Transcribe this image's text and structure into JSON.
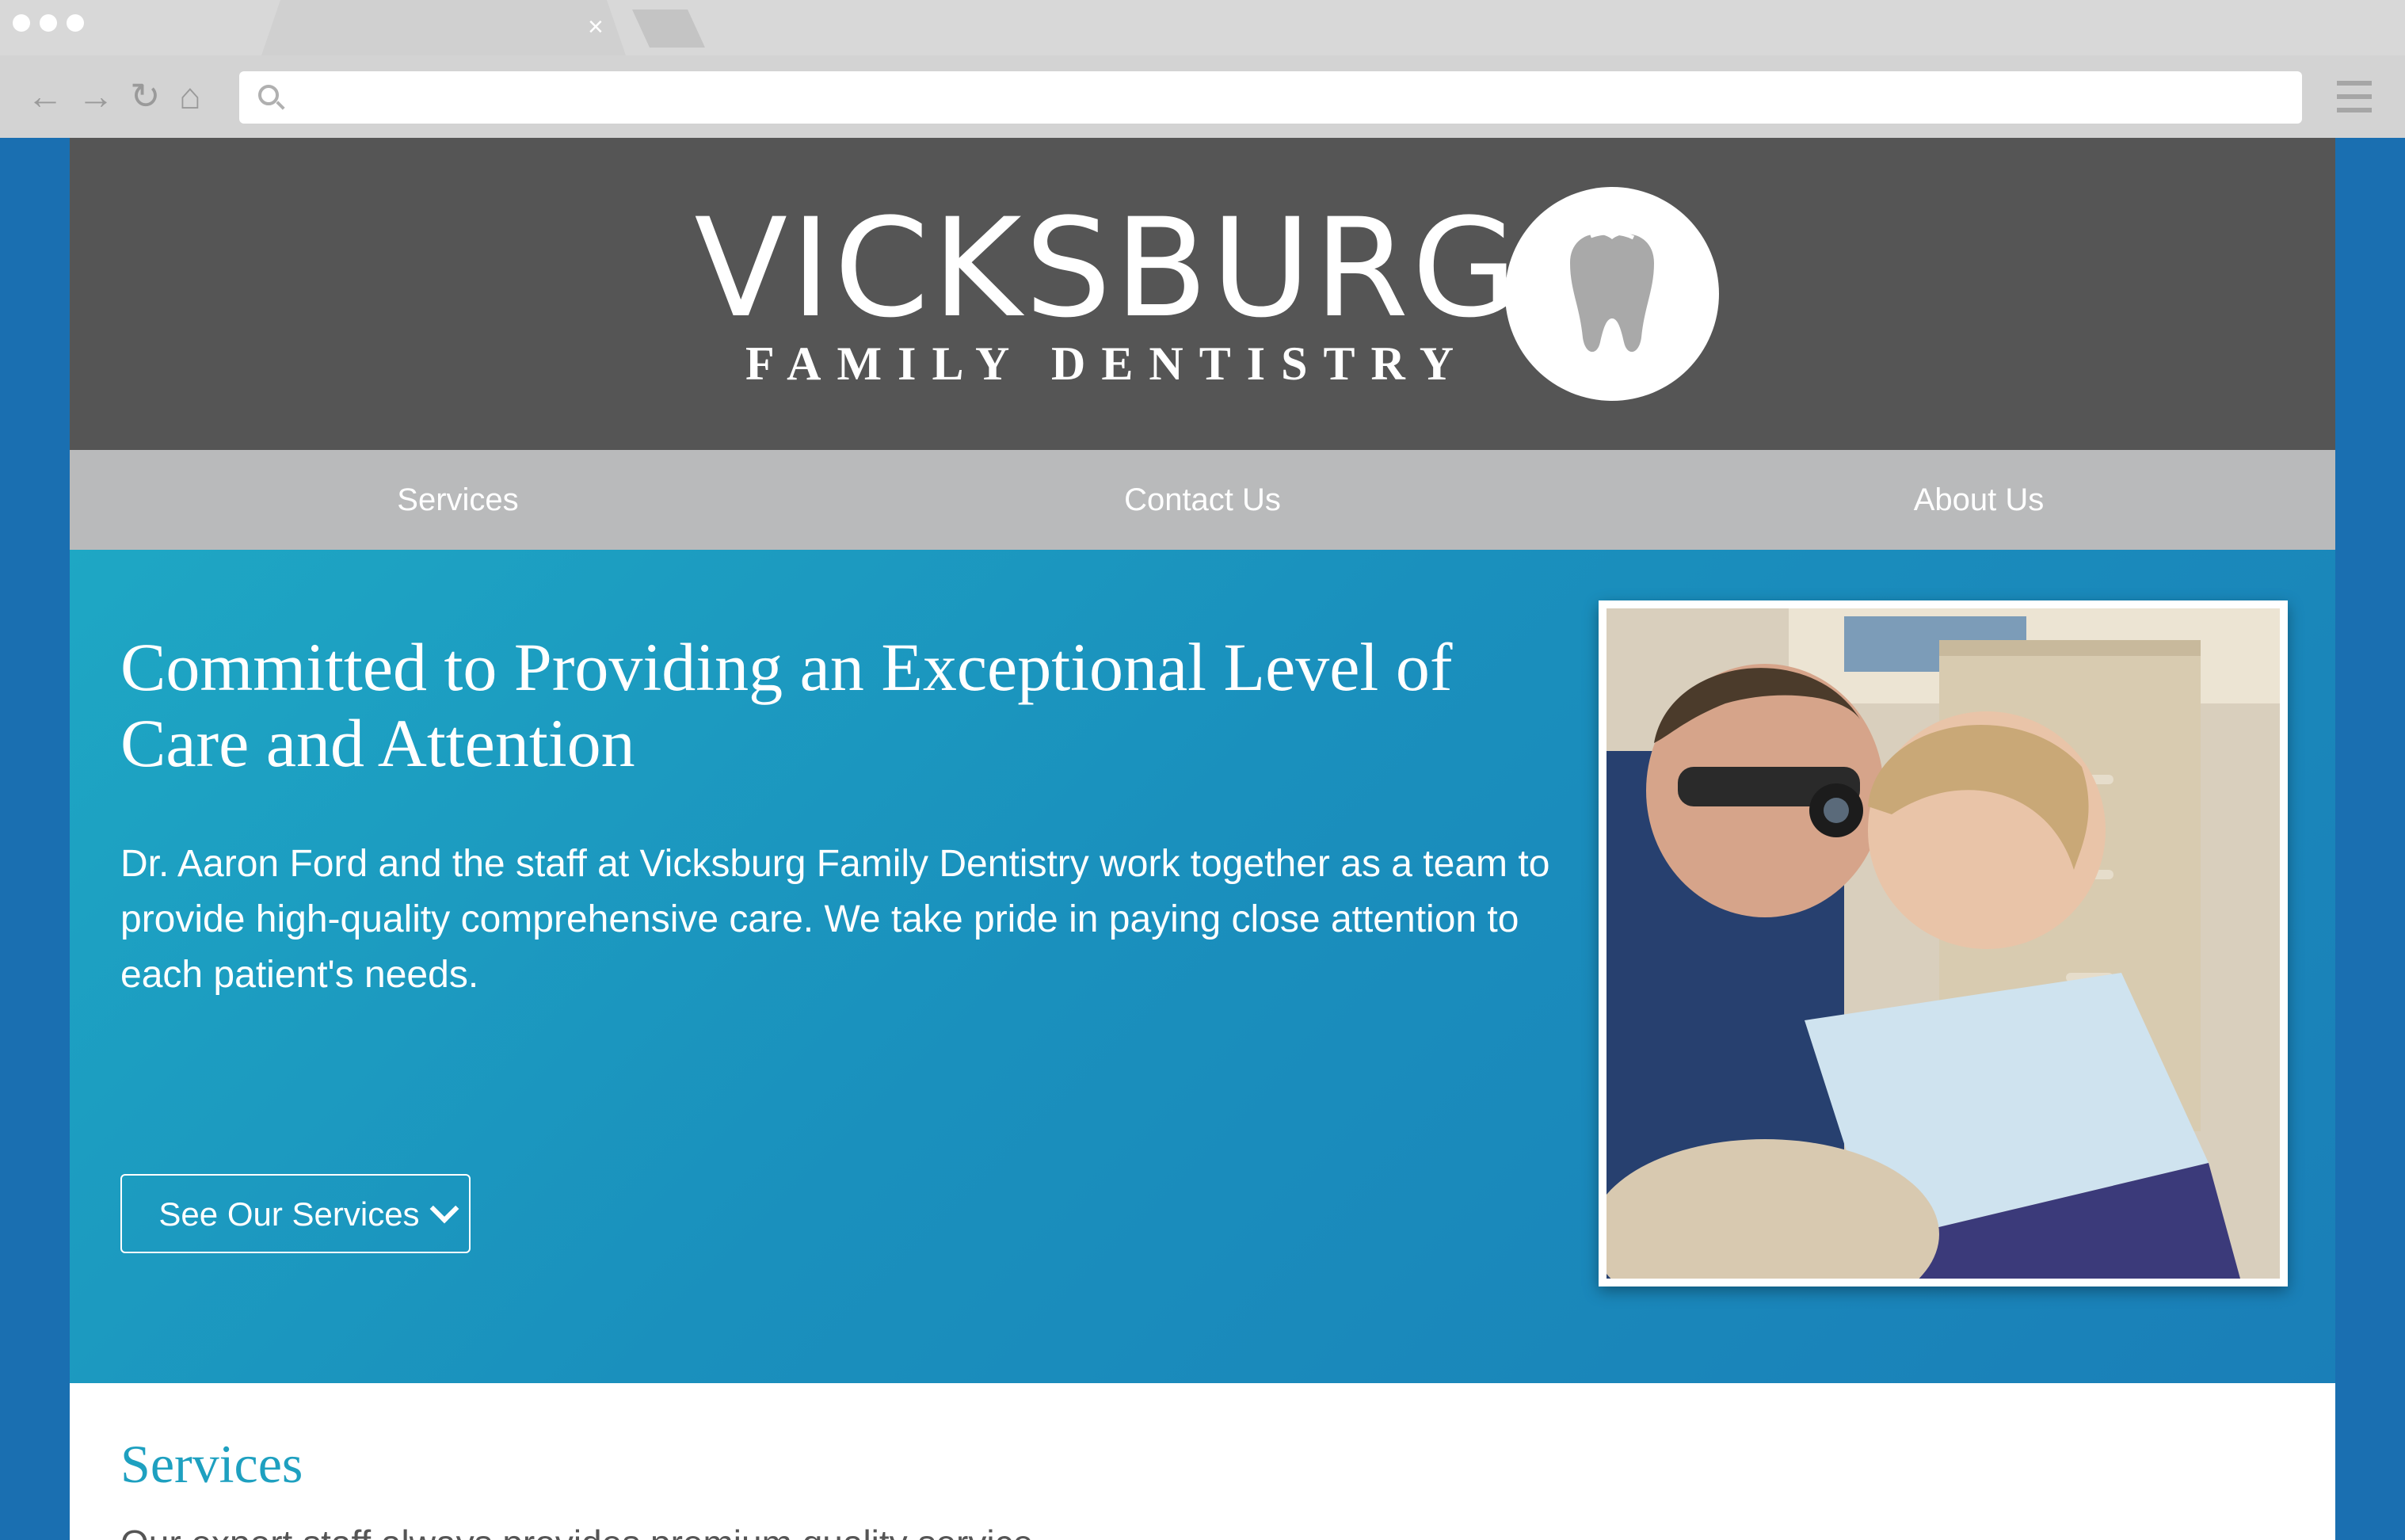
{
  "browser": {
    "close_glyph": "×",
    "back_glyph": "←",
    "forward_glyph": "→",
    "reload_glyph": "↻",
    "home_glyph": "⌂",
    "url": ""
  },
  "logo": {
    "name": "VICKSBURG",
    "tagline": "FAMILY DENTISTRY",
    "icon": "tooth-icon"
  },
  "nav": {
    "items": [
      {
        "label": "Services"
      },
      {
        "label": "Contact Us"
      },
      {
        "label": "About Us"
      }
    ]
  },
  "hero": {
    "title": "Committed to Providing an Exceptional Level of Care and Attention",
    "text": "Dr. Aaron Ford and the staff at Vicksburg Family Dentistry work together as a team to provide high-quality comprehensive care. We take pride in paying close attention to each patient's needs.",
    "button_label": "See Our Services"
  },
  "services": {
    "title": "Services",
    "text": "Our expert staff always provides premium quality service."
  },
  "colors": {
    "header_bg": "#555555",
    "nav_bg": "#b9babb",
    "hero_start": "#1ea7c4",
    "hero_end": "#1a7fb8",
    "accent": "#1ea0c0",
    "page_bg": "#1a6fb1"
  }
}
